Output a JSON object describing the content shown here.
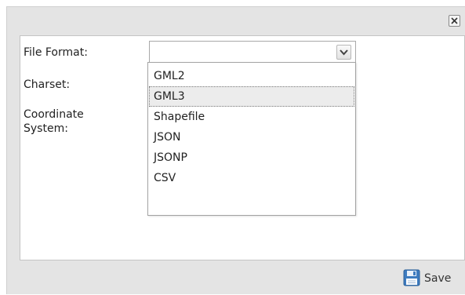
{
  "dialog": {
    "close_glyph": "✕",
    "close_icon": "close-icon"
  },
  "form": {
    "labels": {
      "file_format": "File Format:",
      "charset": "Charset:",
      "coordinate_system_line1": "Coordinate",
      "coordinate_system_line2": "System:"
    },
    "file_format_select": {
      "value": "",
      "arrow_icon": "chevron-down-icon",
      "expanded": true,
      "options": [
        "GML2",
        "GML3",
        "Shapefile",
        "JSON",
        "JSONP",
        "CSV"
      ],
      "highlighted": "GML3"
    }
  },
  "footer": {
    "save_label": "Save",
    "save_icon": "floppy-disk-icon"
  },
  "colors": {
    "dialog_bg": "#e4e4e4",
    "panel_bg": "#ffffff",
    "save_icon": "#3d7bbf"
  }
}
